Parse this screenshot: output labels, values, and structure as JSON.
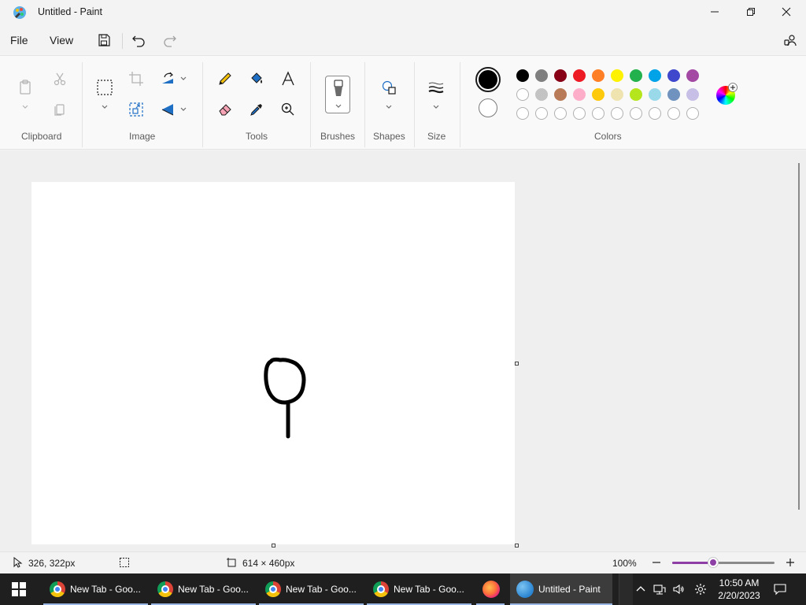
{
  "window": {
    "title": "Untitled - Paint"
  },
  "menu": {
    "file": "File",
    "view": "View"
  },
  "ribbon": {
    "groups": {
      "clipboard": "Clipboard",
      "image": "Image",
      "tools": "Tools",
      "brushes": "Brushes",
      "shapes": "Shapes",
      "size": "Size",
      "colors": "Colors"
    },
    "palette_row1": [
      "#000000",
      "#7f7f7f",
      "#880015",
      "#ed1c24",
      "#ff7f27",
      "#fff200",
      "#22b14c",
      "#00a2e8",
      "#3f48cc",
      "#a349a4"
    ],
    "palette_row2": [
      "#ffffff",
      "#c3c3c3",
      "#b97a57",
      "#ffaec9",
      "#ffc90e",
      "#efe4b0",
      "#b5e61d",
      "#99d9ea",
      "#7092be",
      "#c8bfe7"
    ],
    "palette_row3_count": 10,
    "primary_color": "#000000",
    "secondary_color": "#ffffff"
  },
  "status": {
    "cursor_position": "326, 322px",
    "canvas_size": "614 × 460px",
    "zoom": "100%",
    "zoom_level": 0.4
  },
  "taskbar": {
    "apps": [
      {
        "label": "New Tab - Goo...",
        "icon": "chrome-icon"
      },
      {
        "label": "New Tab - Goo...",
        "icon": "chrome-icon"
      },
      {
        "label": "New Tab - Goo...",
        "icon": "chrome-icon"
      },
      {
        "label": "New Tab - Goo...",
        "icon": "chrome-icon"
      },
      {
        "label": "",
        "icon": "firefox-icon"
      },
      {
        "label": "Untitled - Paint",
        "icon": "paint-icon"
      }
    ],
    "time": "10:50 AM",
    "date": "2/20/2023"
  },
  "colors": {
    "accent": "#8e3fa5",
    "taskbar_bg": "#1f1f1f"
  }
}
